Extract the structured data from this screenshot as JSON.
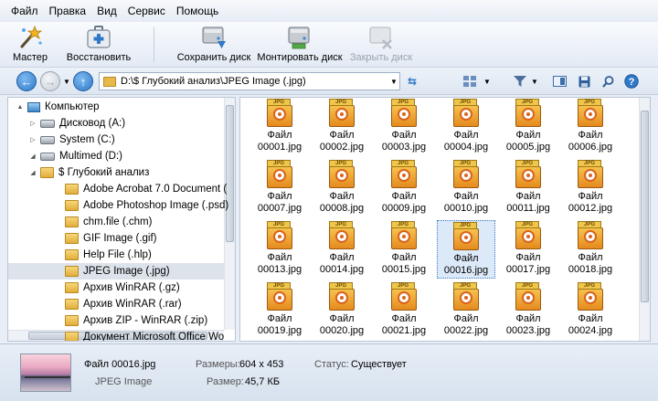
{
  "menu": [
    "Файл",
    "Правка",
    "Вид",
    "Сервис",
    "Помощь"
  ],
  "toolbar": {
    "master": "Мастер",
    "restore": "Восстановить",
    "save_disk": "Сохранить диск",
    "mount_disk": "Монтировать диск",
    "close_disk": "Закрыть диск"
  },
  "address": {
    "path": "D:\\$ Глубокий анализ\\JPEG Image (.jpg)"
  },
  "tree": [
    {
      "label": "Компьютер",
      "level": 0,
      "toggle": "▲",
      "icon": "computer-icon"
    },
    {
      "label": "Дисковод (A:)",
      "level": 1,
      "toggle": "▷",
      "icon": "drive-icon"
    },
    {
      "label": "System (C:)",
      "level": 1,
      "toggle": "▷",
      "icon": "drive-icon"
    },
    {
      "label": "Multimed (D:)",
      "level": 1,
      "toggle": "◢",
      "icon": "drive-icon"
    },
    {
      "label": "$ Глубокий анализ",
      "level": 2,
      "toggle": "◢",
      "icon": "folder-icon"
    },
    {
      "label": "Adobe Acrobat 7.0 Document (",
      "level": 3,
      "toggle": "",
      "icon": "folder-icon"
    },
    {
      "label": "Adobe Photoshop Image (.psd)",
      "level": 3,
      "toggle": "",
      "icon": "folder-icon"
    },
    {
      "label": "chm.file (.chm)",
      "level": 3,
      "toggle": "",
      "icon": "folder-icon"
    },
    {
      "label": "GIF Image (.gif)",
      "level": 3,
      "toggle": "",
      "icon": "folder-icon"
    },
    {
      "label": "Help File (.hlp)",
      "level": 3,
      "toggle": "",
      "icon": "folder-icon"
    },
    {
      "label": "JPEG Image (.jpg)",
      "level": 3,
      "toggle": "",
      "icon": "folder-icon",
      "selected": true
    },
    {
      "label": "Архив WinRAR (.gz)",
      "level": 3,
      "toggle": "",
      "icon": "folder-icon"
    },
    {
      "label": "Архив WinRAR (.rar)",
      "level": 3,
      "toggle": "",
      "icon": "folder-icon"
    },
    {
      "label": "Архив ZIP - WinRAR (.zip)",
      "level": 3,
      "toggle": "",
      "icon": "folder-icon"
    },
    {
      "label": "Документ Microsoft Office Wo",
      "level": 3,
      "toggle": "",
      "icon": "folder-icon"
    }
  ],
  "files": [
    {
      "line1": "Файл",
      "line2": "00001.jpg"
    },
    {
      "line1": "Файл",
      "line2": "00002.jpg"
    },
    {
      "line1": "Файл",
      "line2": "00003.jpg"
    },
    {
      "line1": "Файл",
      "line2": "00004.jpg"
    },
    {
      "line1": "Файл",
      "line2": "00005.jpg"
    },
    {
      "line1": "Файл",
      "line2": "00006.jpg"
    },
    {
      "line1": "Файл",
      "line2": "00007.jpg"
    },
    {
      "line1": "Файл",
      "line2": "00008.jpg"
    },
    {
      "line1": "Файл",
      "line2": "00009.jpg"
    },
    {
      "line1": "Файл",
      "line2": "00010.jpg"
    },
    {
      "line1": "Файл",
      "line2": "00011.jpg"
    },
    {
      "line1": "Файл",
      "line2": "00012.jpg"
    },
    {
      "line1": "Файл",
      "line2": "00013.jpg"
    },
    {
      "line1": "Файл",
      "line2": "00014.jpg"
    },
    {
      "line1": "Файл",
      "line2": "00015.jpg"
    },
    {
      "line1": "Файл",
      "line2": "00016.jpg",
      "selected": true
    },
    {
      "line1": "Файл",
      "line2": "00017.jpg"
    },
    {
      "line1": "Файл",
      "line2": "00018.jpg"
    },
    {
      "line1": "Файл",
      "line2": "00019.jpg"
    },
    {
      "line1": "Файл",
      "line2": "00020.jpg"
    },
    {
      "line1": "Файл",
      "line2": "00021.jpg"
    },
    {
      "line1": "Файл",
      "line2": "00022.jpg"
    },
    {
      "line1": "Файл",
      "line2": "00023.jpg"
    },
    {
      "line1": "Файл",
      "line2": "00024.jpg"
    }
  ],
  "jpg_tab": "JPG",
  "status": {
    "file_name": "Файл 00016.jpg",
    "file_type": "JPEG Image",
    "dims_label": "Размеры:",
    "dims_value": "604 x 453",
    "size_label": "Размер:",
    "size_value": "45,7 КБ",
    "state_label": "Статус:",
    "state_value": "Существует"
  },
  "colors": {
    "nav_blue": "#2f79c9",
    "selection": "#dce9f8",
    "folder": "#e2ad3b"
  }
}
